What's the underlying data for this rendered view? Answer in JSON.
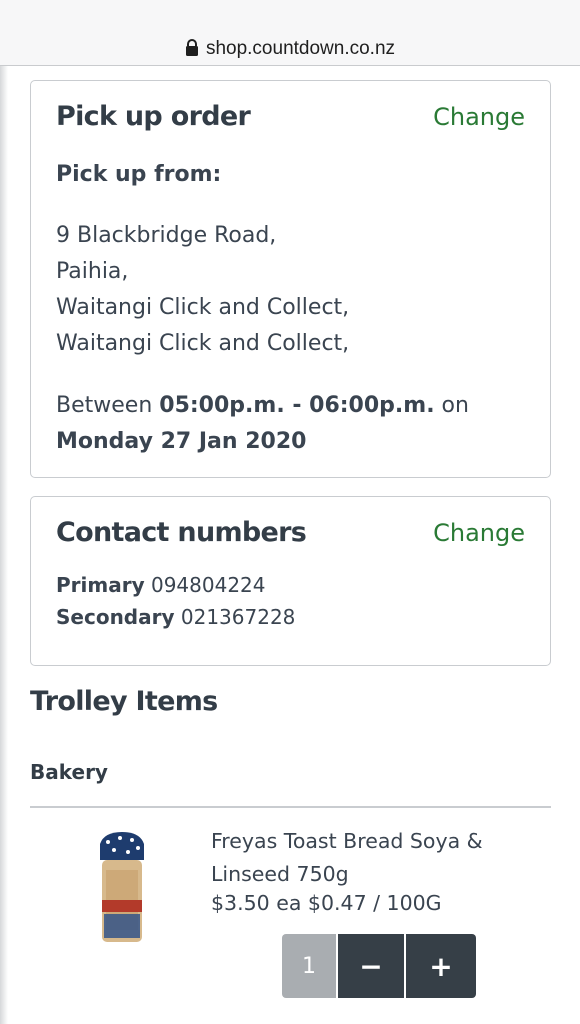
{
  "browser": {
    "url": "shop.countdown.co.nz"
  },
  "pickup": {
    "title": "Pick up order",
    "change_label": "Change",
    "from_label": "Pick up from:",
    "address_lines": [
      "9 Blackbridge Road,",
      "Paihia,",
      "Waitangi Click and Collect,",
      "Waitangi Click and Collect,"
    ],
    "between_label": "Between",
    "time_range": "05:00p.m. - 06:00p.m.",
    "on_label": "on",
    "date": "Monday 27 Jan 2020"
  },
  "contact": {
    "title": "Contact numbers",
    "change_label": "Change",
    "primary_label": "Primary",
    "primary_number": "094804224",
    "secondary_label": "Secondary",
    "secondary_number": "021367228"
  },
  "trolley": {
    "title": "Trolley Items",
    "department": "Bakery",
    "items": [
      {
        "name": "Freyas Toast Bread Soya & Linseed 750g",
        "price": "$3.50 ea",
        "unit_price": "$0.47 / 100G",
        "quantity": "1",
        "minus_label": "−",
        "plus_label": "+",
        "image_icon": "bread-loaf-icon"
      }
    ]
  },
  "colors": {
    "accent_green": "#2a7a35",
    "text_dark": "#333d47",
    "button_dark": "#363f47",
    "qty_grey": "#a9adb1"
  }
}
